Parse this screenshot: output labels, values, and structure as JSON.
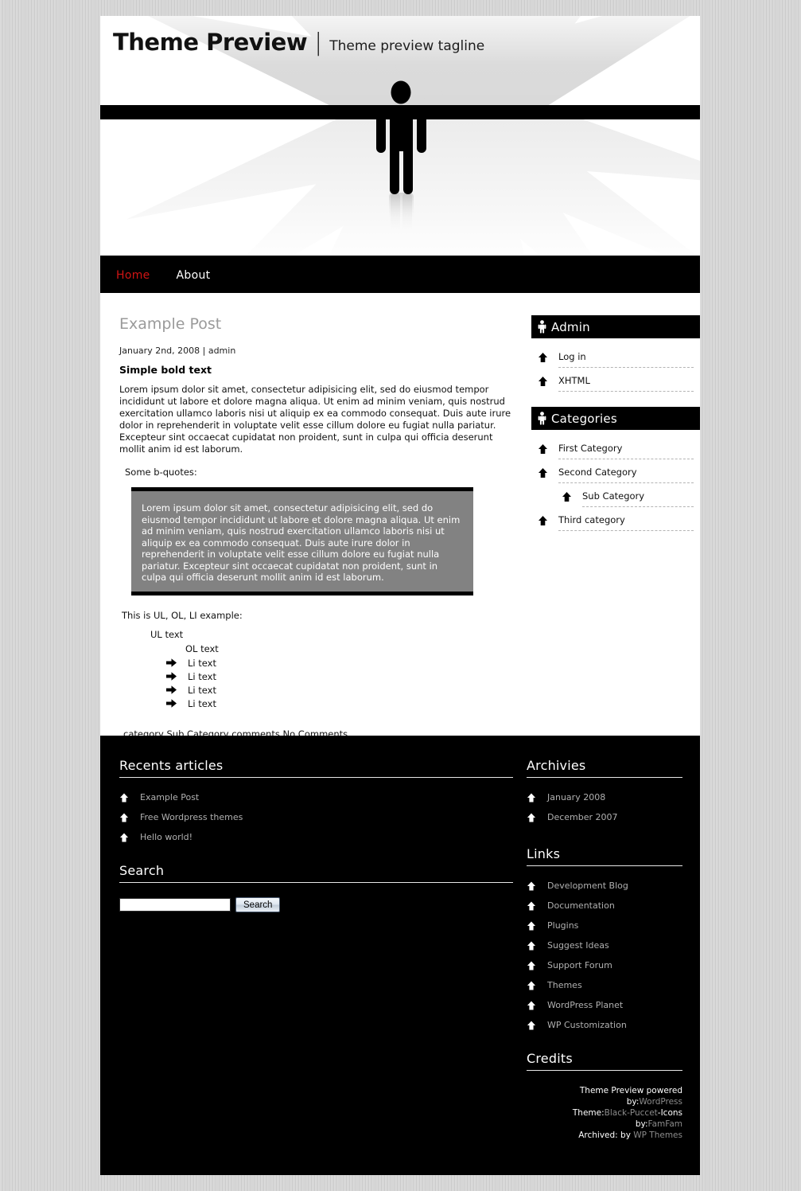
{
  "header": {
    "site_title": "Theme Preview",
    "separator": "|",
    "tagline": "Theme preview tagline",
    "figure_icon": "person-silhouette-icon"
  },
  "nav": {
    "items": [
      {
        "label": "Home",
        "current": true
      },
      {
        "label": "About",
        "current": false
      }
    ]
  },
  "post": {
    "title": "Example Post",
    "meta": "January 2nd, 2008 | admin",
    "subtitle": "Simple bold text",
    "body": "Lorem ipsum dolor sit amet, consectetur adipisicing elit, sed do eiusmod tempor incididunt ut labore et dolore magna aliqua. Ut enim ad minim veniam, quis nostrud exercitation ullamco laboris nisi ut aliquip ex ea commodo consequat. Duis aute irure dolor in reprehenderit in voluptate velit esse cillum dolore eu fugiat nulla pariatur. Excepteur sint occaecat cupidatat non proident, sunt in culpa qui officia deserunt mollit anim id est laborum.",
    "bquote_label": "Some b-quotes:",
    "blockquote": "Lorem ipsum dolor sit amet, consectetur adipisicing elit, sed do eiusmod tempor incididunt ut labore et dolore magna aliqua. Ut enim ad minim veniam, quis nostrud exercitation ullamco laboris nisi ut aliquip ex ea commodo consequat. Duis aute irure dolor in reprehenderit in voluptate velit esse cillum dolore eu fugiat nulla pariatur. Excepteur sint occaecat cupidatat non proident, sunt in culpa qui officia deserunt mollit anim id est laborum.",
    "list_label": "This is UL, OL, LI example:",
    "ul_text": "UL text",
    "ol_text": "OL text",
    "li_items": [
      "Li text",
      "Li text",
      "Li text",
      "Li text"
    ],
    "footer": {
      "category_label": "category",
      "category_link": "Sub Category",
      "comments_label": "comments",
      "comments_link": "No Comments"
    }
  },
  "sidebar": {
    "widgets": [
      {
        "title": "Admin",
        "icon": "person-icon",
        "items": [
          {
            "label": "Log in",
            "sub": false
          },
          {
            "label": "XHTML",
            "sub": false
          }
        ]
      },
      {
        "title": "Categories",
        "icon": "person-icon",
        "items": [
          {
            "label": "First Category",
            "sub": false
          },
          {
            "label": "Second Category",
            "sub": false
          },
          {
            "label": "Sub Category",
            "sub": true
          },
          {
            "label": "Third category",
            "sub": false
          }
        ]
      }
    ]
  },
  "footer": {
    "recents": {
      "title": "Recents articles",
      "items": [
        "Example Post",
        "Free Wordpress themes",
        "Hello world!"
      ]
    },
    "search": {
      "title": "Search",
      "value": "",
      "placeholder": "",
      "button_label": "Search"
    },
    "archives": {
      "title": "Archivies",
      "items": [
        "January 2008",
        "December 2007"
      ]
    },
    "links": {
      "title": "Links",
      "items": [
        "Development Blog",
        "Documentation",
        "Plugins",
        "Suggest Ideas",
        "Support Forum",
        "Themes",
        "WordPress Planet",
        "WP Customization"
      ]
    },
    "credits": {
      "title": "Credits",
      "line1_text": "Theme Preview powered by:",
      "line1_link": "WordPress",
      "line2_text": "Theme:",
      "line2_link1": "Black-Puccet",
      "line2_mid": "-Icons by:",
      "line2_link2": "FamFam",
      "line3_text": "Archived: by ",
      "line3_link": "WP Themes"
    }
  },
  "colors": {
    "accent_red": "#d01414",
    "page_black": "#000000",
    "blockquote_gray": "#828282",
    "link_gray": "#b0b0b0"
  }
}
